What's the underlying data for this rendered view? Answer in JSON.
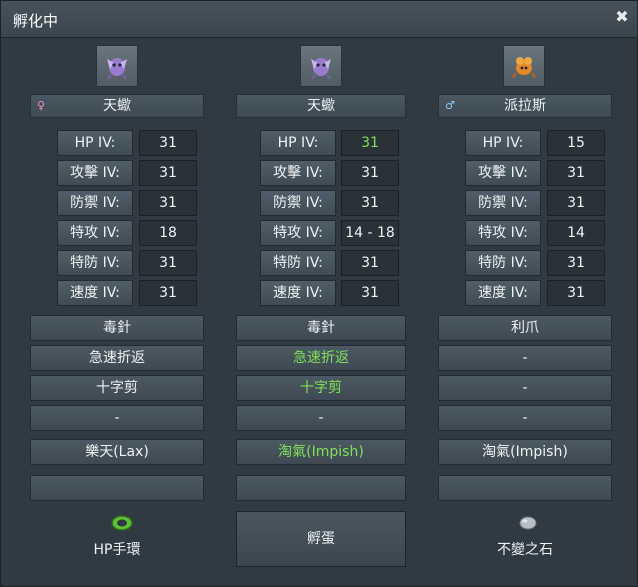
{
  "window": {
    "title": "孵化中",
    "close_glyph": "✖"
  },
  "columns": [
    {
      "icon": "purple-insect-pokemon-icon",
      "gender": "♀",
      "gender_type": "female",
      "name": "天蠍",
      "ivs": [
        {
          "label": "HP IV:",
          "value": "31",
          "highlight": false
        },
        {
          "label": "攻擊 IV:",
          "value": "31",
          "highlight": false
        },
        {
          "label": "防禦 IV:",
          "value": "31",
          "highlight": false
        },
        {
          "label": "特攻 IV:",
          "value": "18",
          "highlight": false
        },
        {
          "label": "特防 IV:",
          "value": "31",
          "highlight": false
        },
        {
          "label": "速度 IV:",
          "value": "31",
          "highlight": false
        }
      ],
      "moves": [
        {
          "name": "毒針",
          "highlight": false
        },
        {
          "name": "急速折返",
          "highlight": false
        },
        {
          "name": "十字剪",
          "highlight": false
        },
        {
          "name": "-",
          "highlight": false
        }
      ],
      "nature": {
        "name": "樂天(Lax)",
        "highlight": false
      },
      "ability": "",
      "item": {
        "icon": "green-bracer-icon",
        "label": "HP手環"
      }
    },
    {
      "icon": "purple-insect-pokemon-icon",
      "gender": "",
      "gender_type": "none",
      "name": "天蠍",
      "ivs": [
        {
          "label": "HP IV:",
          "value": "31",
          "highlight": true
        },
        {
          "label": "攻擊 IV:",
          "value": "31",
          "highlight": false
        },
        {
          "label": "防禦 IV:",
          "value": "31",
          "highlight": false
        },
        {
          "label": "特攻 IV:",
          "value": "14 - 18",
          "highlight": false
        },
        {
          "label": "特防 IV:",
          "value": "31",
          "highlight": false
        },
        {
          "label": "速度 IV:",
          "value": "31",
          "highlight": false
        }
      ],
      "moves": [
        {
          "name": "毒針",
          "highlight": false
        },
        {
          "name": "急速折返",
          "highlight": true
        },
        {
          "name": "十字剪",
          "highlight": true
        },
        {
          "name": "-",
          "highlight": false
        }
      ],
      "nature": {
        "name": "淘氣(Impish)",
        "highlight": true
      },
      "ability": "",
      "hatch_label": "孵蛋"
    },
    {
      "icon": "orange-crab-pokemon-icon",
      "gender": "♂",
      "gender_type": "male",
      "name": "派拉斯",
      "ivs": [
        {
          "label": "HP IV:",
          "value": "15",
          "highlight": false
        },
        {
          "label": "攻擊 IV:",
          "value": "31",
          "highlight": false
        },
        {
          "label": "防禦 IV:",
          "value": "31",
          "highlight": false
        },
        {
          "label": "特攻 IV:",
          "value": "14",
          "highlight": false
        },
        {
          "label": "特防 IV:",
          "value": "31",
          "highlight": false
        },
        {
          "label": "速度 IV:",
          "value": "31",
          "highlight": false
        }
      ],
      "moves": [
        {
          "name": "利爪",
          "highlight": false
        },
        {
          "name": "-",
          "highlight": false
        },
        {
          "name": "-",
          "highlight": false
        },
        {
          "name": "-",
          "highlight": false
        }
      ],
      "nature": {
        "name": "淘氣(Impish)",
        "highlight": false
      },
      "ability": "",
      "item": {
        "icon": "gray-everstone-icon",
        "label": "不變之石"
      }
    }
  ],
  "colors": {
    "highlight": "#7fe05a",
    "female": "#f08ad0",
    "male": "#8fc8ff"
  }
}
